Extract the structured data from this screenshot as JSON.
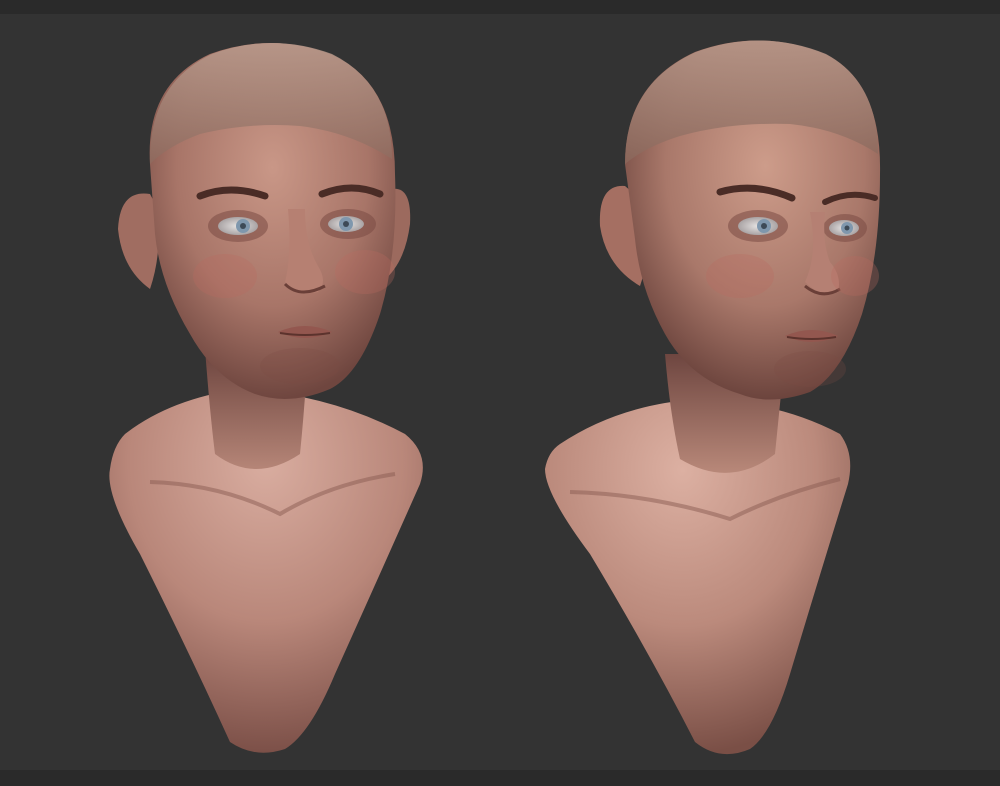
{
  "canvas": {
    "background": "#333333",
    "frame_color": "#2a2a2a"
  },
  "renders": [
    {
      "id": "front-view",
      "view": "front",
      "skin_light": "#d8a896",
      "skin_mid": "#b07c70",
      "skin_dark": "#7a4e47",
      "iris": "#7f97ad"
    },
    {
      "id": "three-quarter-view",
      "view": "three-quarter",
      "skin_light": "#d9ab98",
      "skin_mid": "#b08072",
      "skin_dark": "#75493f",
      "iris": "#7f97ad"
    }
  ]
}
